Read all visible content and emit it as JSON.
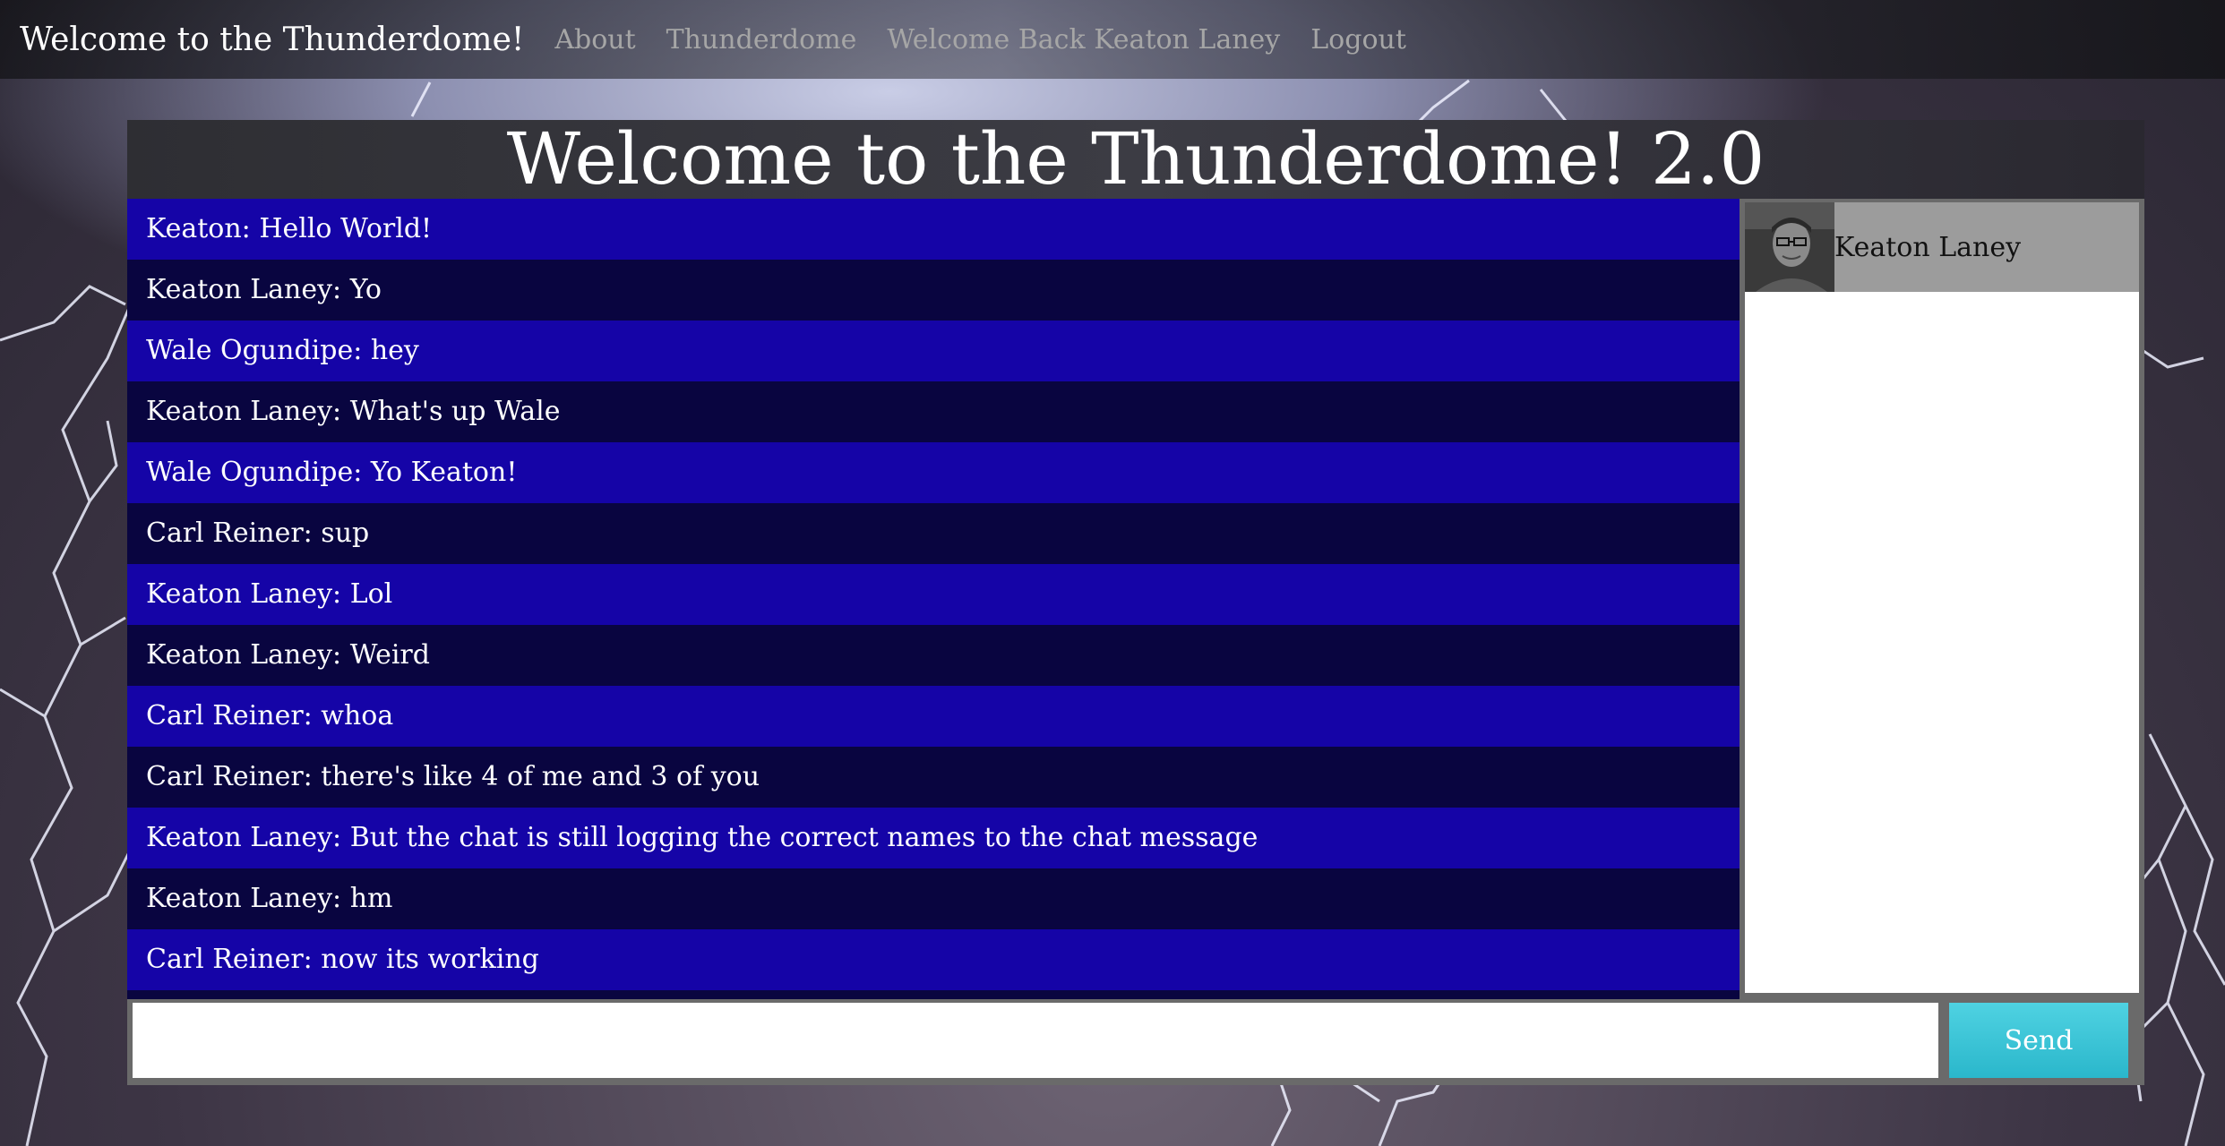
{
  "navbar": {
    "brand": "Welcome to the Thunderdome!",
    "links": [
      "About",
      "Thunderdome",
      "Welcome Back Keaton Laney",
      "Logout"
    ]
  },
  "main": {
    "title": "Welcome to the Thunderdome! 2.0",
    "messages": [
      "Keaton: Hello World!",
      "Keaton Laney: Yo",
      "Wale Ogundipe: hey",
      "Keaton Laney: What's up Wale",
      "Wale Ogundipe: Yo Keaton!",
      "Carl Reiner: sup",
      "Keaton Laney: Lol",
      "Keaton Laney: Weird",
      "Carl Reiner: whoa",
      "Carl Reiner: there's like 4 of me and 3 of you",
      "Keaton Laney: But the chat is still logging the correct names to the chat message",
      "Keaton Laney: hm",
      "Carl Reiner: now its working"
    ],
    "users": [
      {
        "name": "Keaton Laney",
        "icon": "avatar-photo"
      }
    ],
    "input": {
      "value": ""
    },
    "send_label": "Send"
  },
  "colors": {
    "message_odd": "#1504a7",
    "message_even": "#090540",
    "send_button": "#35c4d6",
    "nav_link": "#a6a6a6"
  }
}
